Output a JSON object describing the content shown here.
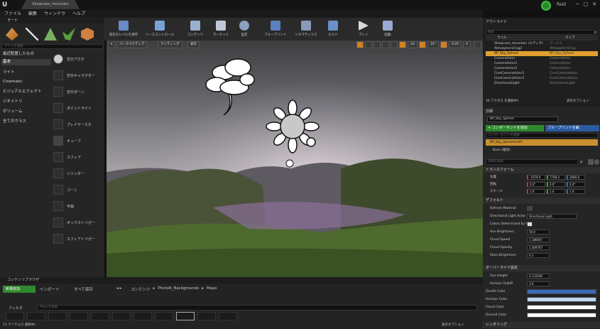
{
  "title_bar": {
    "logo": "U",
    "project_tab": "Showcase_mountain",
    "user_name": "field",
    "win_min": "─",
    "win_max": "□",
    "win_close": "✕"
  },
  "menu": [
    "ファイル",
    "編集",
    "ウィンドウ",
    "ヘルプ"
  ],
  "toolbar": {
    "items": [
      "現在のレベルを保存",
      "ソースコントロール",
      "コンテンツ",
      "マーケット",
      "設定",
      "ブループリント",
      "シネマティクス",
      "ビルド",
      "プレイ",
      "起動"
    ]
  },
  "modes": {
    "header": "モード",
    "search_placeholder": "クラスを検索",
    "categories": [
      "最近配置したもの",
      "基本",
      "ライト",
      "Cinematic",
      "ビジュアルエフェクト",
      "ジオメトリ",
      "ボリューム",
      "全てのクラス"
    ],
    "selected_category": "基本",
    "assets": [
      "空のアクタ",
      "空のキャラクター",
      "空のポーン",
      "ポイントライト",
      "プレイヤースタ",
      "キューブ",
      "スフィア",
      "シリンダー",
      "コーン",
      "平面",
      "ボックストリガー",
      "スフィアトリガー"
    ]
  },
  "viewport": {
    "perspective": "パースペクティブ",
    "lighting": "ライティング",
    "show": "表示",
    "grid_snap": "10",
    "rot_snap": "10°",
    "scale_snap": "0.25",
    "cam_speed": "4"
  },
  "outliner": {
    "header": "アウトライナ",
    "search_placeholder": "検索",
    "col_label": "ラベル",
    "col_type": "タイプ",
    "rows": [
      {
        "name": "Showcase_mountain (エディタ)",
        "type": "ワールド"
      },
      {
        "name": "AtmosphericFog2",
        "type": "AtmosphericFog"
      },
      {
        "name": "BP_Sky_Sphere",
        "type": "BP_Sky_Sphere"
      },
      {
        "name": "CameraActor",
        "type": "CameraActor"
      },
      {
        "name": "CameraActor1",
        "type": "CameraActor"
      },
      {
        "name": "CameraActor2",
        "type": "CameraActor"
      },
      {
        "name": "CineCameraActor1",
        "type": "CineCameraActor"
      },
      {
        "name": "CineCameraActor2",
        "type": "CineCameraActor"
      },
      {
        "name": "DirectionalLight",
        "type": "DirectionalLight"
      }
    ],
    "selected_row": "BP_Sky_Sphere",
    "footer": "26 アクタ(1 を選択中)",
    "view_options": "表示オプション"
  },
  "details": {
    "header": "詳細",
    "actor_name": "BP_Sky_Sphere",
    "add_component": "+ コンポーネントを追加",
    "blueprint_button": "ブループリントを編",
    "component_search": "コンポーネントを検索",
    "component_root": "BP_Sky_Sphere(self)",
    "component_base": "Base (継承)",
    "detail_search": "詳細を検索",
    "transform_header": "トランスフォーム",
    "location_label": "位置",
    "location": [
      "-1079.6",
      "7748.4",
      "2060.6"
    ],
    "rotation_label": "回転",
    "rotation": [
      "0.0°",
      "0.0°",
      "0.0°"
    ],
    "scale_label": "スケール",
    "scale": [
      "1.0",
      "1.0",
      "1.0"
    ],
    "default_header": "デフォルト",
    "props": [
      {
        "label": "Refresh Material",
        "value": ""
      },
      {
        "label": "Directional Light Actor",
        "value": "Directional Light"
      },
      {
        "label": "Colors Determined by Sun",
        "value": ""
      },
      {
        "label": "Sun Brightness",
        "value": "50.0"
      },
      {
        "label": "Cloud Speed",
        "value": "1.186007"
      },
      {
        "label": "Cloud Opacity",
        "value": "1.409767"
      },
      {
        "label": "Stars Brightness",
        "value": "0.1"
      }
    ],
    "override_header": "オーバーライド設定",
    "override_props": [
      {
        "label": "Sun Height",
        "value": "0.133546"
      },
      {
        "label": "Horizon Falloff",
        "value": "3.0"
      }
    ],
    "colors": [
      {
        "label": "Zenith Color",
        "color": "#3a6ab8"
      },
      {
        "label": "Horizon Color",
        "color": "#c0d8f0"
      },
      {
        "label": "Cloud Color",
        "color": "#ffffff"
      },
      {
        "label": "Overall Color",
        "color": "#ffffff"
      }
    ],
    "rendering_header": "レンダリング"
  },
  "content_browser": {
    "header": "コンテンツブラウザ",
    "add_new": "新規追加",
    "import": "インポート",
    "save_all": "すべて保存",
    "path": [
      "コンテンツ",
      "PhotoR_Backgrounds",
      "Maps"
    ],
    "filters": "フィルタ",
    "search_placeholder": "Mapsを検索",
    "footer": "11 アイテム(1 選択中)",
    "view_options": "表示オプション"
  }
}
